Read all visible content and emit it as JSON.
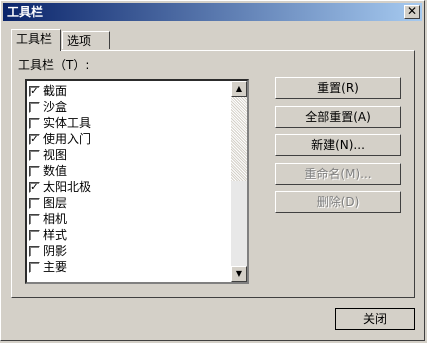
{
  "window": {
    "title": "工具栏",
    "close_glyph": "✕"
  },
  "tabs": [
    {
      "label": "工具栏"
    },
    {
      "label": "选项"
    }
  ],
  "list_label": "工具栏（T）:",
  "items": [
    {
      "label": "截面",
      "checked": true
    },
    {
      "label": "沙盒",
      "checked": false
    },
    {
      "label": "实体工具",
      "checked": false
    },
    {
      "label": "使用入门",
      "checked": true
    },
    {
      "label": "视图",
      "checked": false
    },
    {
      "label": "数值",
      "checked": false
    },
    {
      "label": "太阳北极",
      "checked": true
    },
    {
      "label": "图层",
      "checked": false
    },
    {
      "label": "相机",
      "checked": false
    },
    {
      "label": "样式",
      "checked": false
    },
    {
      "label": "阴影",
      "checked": false
    },
    {
      "label": "主要",
      "checked": false
    }
  ],
  "buttons": {
    "reset": "重置(R)",
    "reset_all": "全部重置(A)",
    "new": "新建(N)...",
    "rename": "重命名(M)...",
    "delete": "删除(D)",
    "close": "关闭"
  }
}
